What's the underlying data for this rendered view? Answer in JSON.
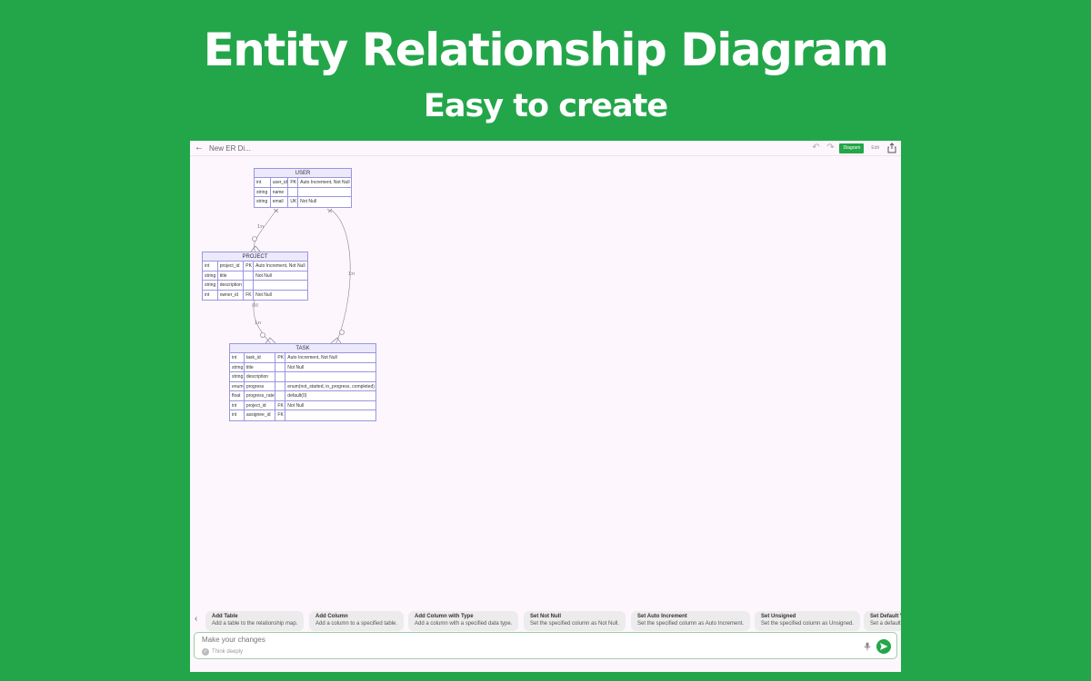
{
  "hero": {
    "title": "Entity Relationship Diagram",
    "subtitle": "Easy to create"
  },
  "topbar": {
    "back_icon": "arrow-left-icon",
    "doc_title": "New ER Di...",
    "undo_icon": "undo-icon",
    "redo_icon": "redo-icon",
    "diagram_label": "Diagram",
    "edit_label": "Edit",
    "share_icon": "share-icon"
  },
  "entities": {
    "user": {
      "name": "USER",
      "rows": [
        [
          "int",
          "user_id",
          "PK",
          "Auto Increment, Not Null"
        ],
        [
          "string",
          "name",
          "",
          ""
        ],
        [
          "string",
          "email",
          "UK",
          "Not Null"
        ]
      ]
    },
    "project": {
      "name": "PROJECT",
      "rows": [
        [
          "int",
          "project_id",
          "PK",
          "Auto Increment, Not Null"
        ],
        [
          "string",
          "title",
          "",
          "Not Null"
        ],
        [
          "string",
          "description",
          "",
          ""
        ],
        [
          "int",
          "owner_id",
          "FK",
          "Not Null"
        ]
      ]
    },
    "task": {
      "name": "TASK",
      "rows": [
        [
          "int",
          "task_id",
          "PK",
          "Auto Increment, Not Null"
        ],
        [
          "string",
          "title",
          "",
          "Not Null"
        ],
        [
          "string",
          "description",
          "",
          ""
        ],
        [
          "enum",
          "progress",
          "",
          "enum(not_started, in_progress, completed)"
        ],
        [
          "float",
          "progress_rate",
          "",
          "default(0)"
        ],
        [
          "int",
          "project_id",
          "FK",
          "Not Null"
        ],
        [
          "int",
          "assignee_id",
          "FK",
          ""
        ]
      ]
    }
  },
  "relations": {
    "user_project": "1:n",
    "user_task": "1:n",
    "project_task": "1:n"
  },
  "suggestions": [
    {
      "title": "Add Table",
      "desc": "Add a table to the relationship map."
    },
    {
      "title": "Add Column",
      "desc": "Add a column to a specified table."
    },
    {
      "title": "Add Column with Type",
      "desc": "Add a column with a specified data type."
    },
    {
      "title": "Set Not Null",
      "desc": "Set the specified column as Not Null."
    },
    {
      "title": "Set Auto Increment",
      "desc": "Set the specified column as Auto Increment."
    },
    {
      "title": "Set Unsigned",
      "desc": "Set the specified column as Unsigned."
    },
    {
      "title": "Set Default V",
      "desc": "Set a default"
    }
  ],
  "composer": {
    "placeholder": "Make your changes",
    "think_label": "Think deeply",
    "mic_icon": "microphone-icon",
    "send_icon": "send-icon"
  },
  "colors": {
    "brand": "#23a64a",
    "canvas": "#fdf7fd",
    "entity_border": "#9b95e0",
    "entity_header": "#ece9fb"
  }
}
